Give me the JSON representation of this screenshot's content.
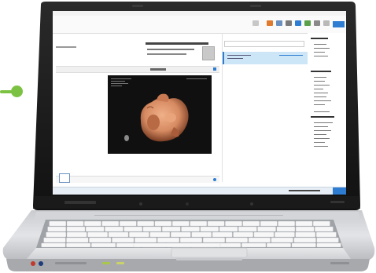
{
  "scene": {
    "subject": "laptop-displaying-email-with-3d-ultrasound-photo",
    "colors": {
      "lid": "#1c1c1c",
      "base": "#d9dadd",
      "keys": "#f4f4f5",
      "pointer": "#7cc242",
      "screen_accent": "#2e7dd3",
      "photo_skin": "#d78b62"
    }
  },
  "email_client": {
    "status_bar_text": "",
    "list_selected": true
  }
}
